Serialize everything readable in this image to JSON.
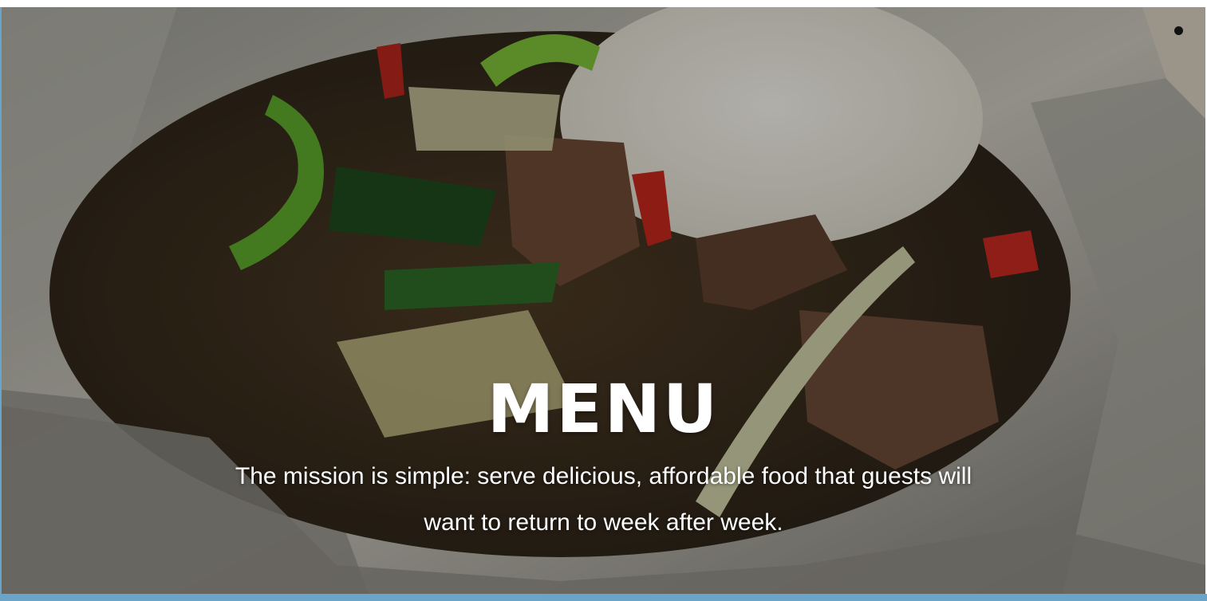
{
  "hero": {
    "title": "MENU",
    "tagline": "The mission is simple: serve delicious, affordable food that guests will want to return to week after week.",
    "image_description_icon": "food-photo"
  },
  "colors": {
    "title_text": "#ffffff",
    "accent_bar": "#6aa4c8"
  }
}
